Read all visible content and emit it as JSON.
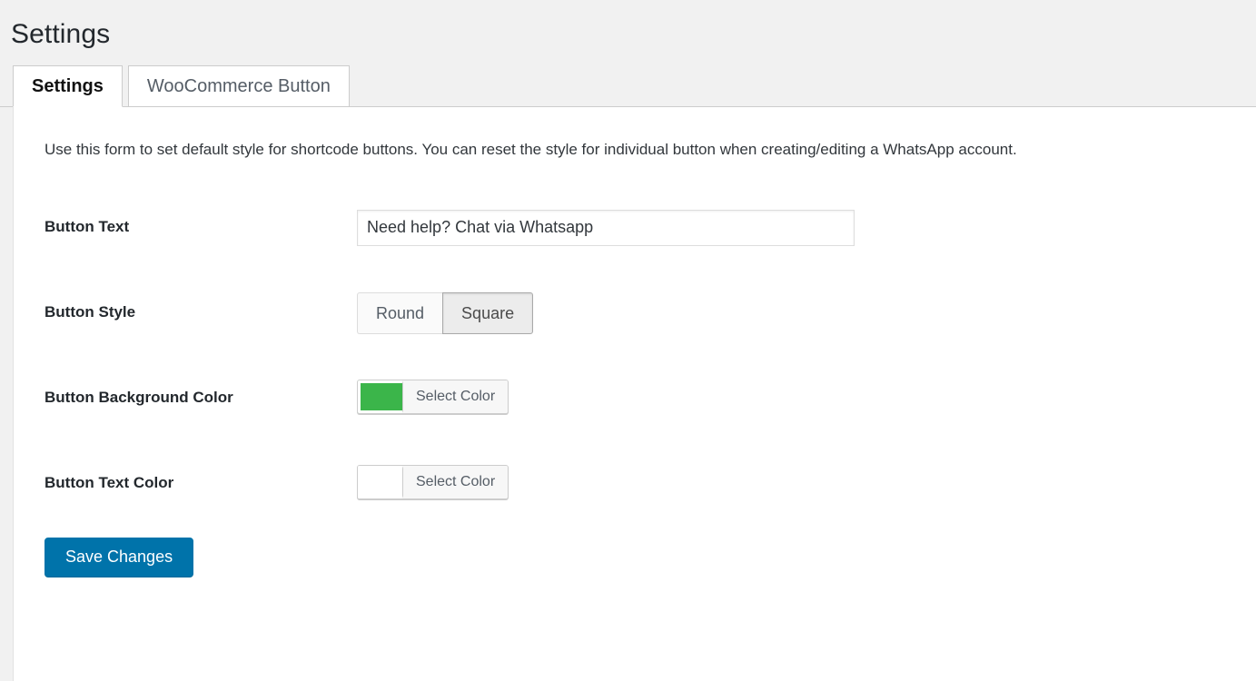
{
  "header": {
    "title": "Settings"
  },
  "tabs": [
    {
      "label": "Settings",
      "active": true
    },
    {
      "label": "WooCommerce Button",
      "active": false
    }
  ],
  "main": {
    "description": "Use this form to set default style for shortcode buttons. You can reset the style for individual button when creating/editing a WhatsApp account.",
    "fields": {
      "button_text": {
        "label": "Button Text",
        "value": "Need help? Chat via Whatsapp",
        "placeholder": ""
      },
      "button_style": {
        "label": "Button Style",
        "options": [
          "Round",
          "Square"
        ],
        "selected": "Square"
      },
      "button_background_color": {
        "label": "Button Background Color",
        "select_label": "Select Color",
        "color": "#3bb54a"
      },
      "button_text_color": {
        "label": "Button Text Color",
        "select_label": "Select Color",
        "color": "#ffffff"
      }
    },
    "save_button": "Save Changes"
  },
  "colors": {
    "page_background": "#f1f1f1",
    "panel_background": "#ffffff",
    "primary_button": "#0073aa",
    "accent_green": "#3bb54a",
    "text": "#23282d"
  }
}
